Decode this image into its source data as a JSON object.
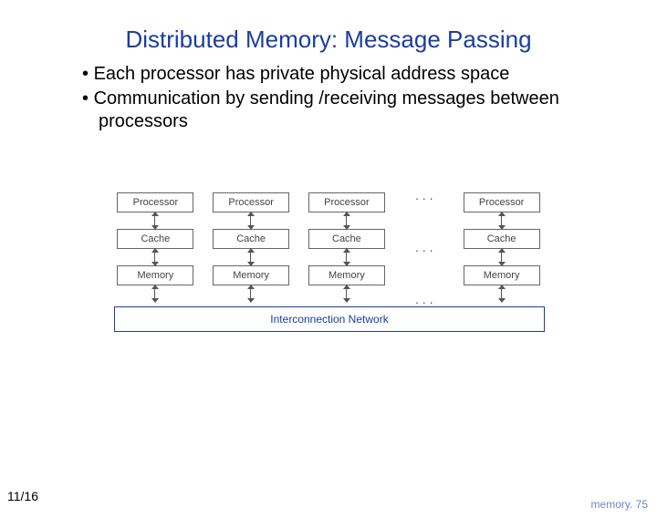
{
  "title": "Distributed Memory: Message Passing",
  "bullets": [
    "Each processor has private physical address space",
    "Communication by  sending /receiving messages between processors"
  ],
  "diagram": {
    "stack_labels": {
      "proc": "Processor",
      "cache": "Cache",
      "mem": "Memory"
    },
    "ellipsis_top": ". . .",
    "ellipsis_mid": ". . .",
    "ellipsis_bot": ". . .",
    "network_label": "Interconnection Network"
  },
  "footer": {
    "left": "11/16",
    "right": "memory. 75"
  }
}
